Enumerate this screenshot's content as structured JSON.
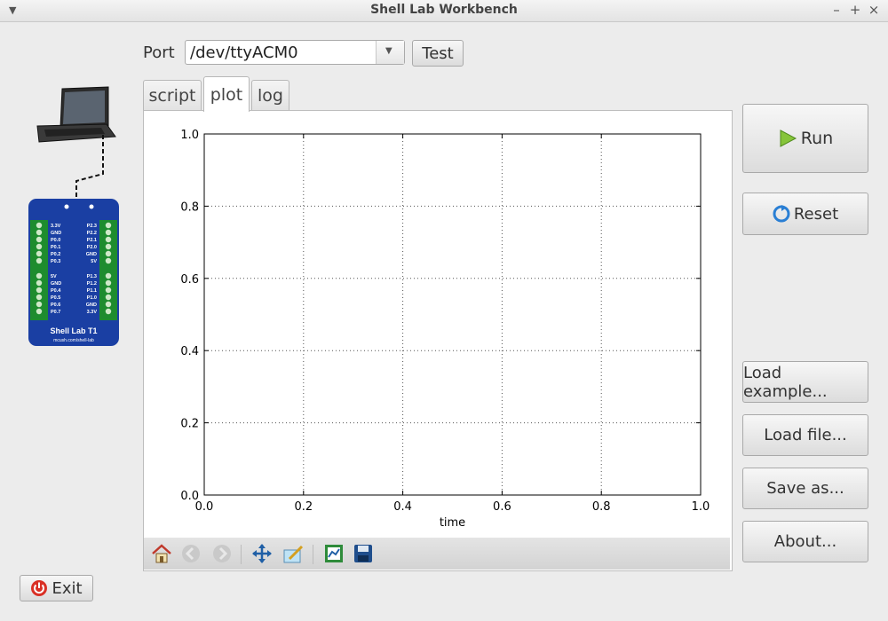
{
  "window": {
    "title": "Shell Lab Workbench",
    "controls": [
      "–",
      "+",
      "×"
    ]
  },
  "port": {
    "label": "Port",
    "value": "/dev/ttyACM0",
    "test_label": "Test"
  },
  "tabs": [
    {
      "label": "script",
      "active": false
    },
    {
      "label": "plot",
      "active": true
    },
    {
      "label": "log",
      "active": false
    }
  ],
  "board": {
    "name": "Shell Lab T1",
    "url": "mcush.com/shell-lab",
    "left_pins": [
      "3.3V",
      "GND",
      "P0.0",
      "P0.1",
      "P0.2",
      "P0.3",
      "5V",
      "GND",
      "P0.4",
      "P0.5",
      "P0.6",
      "P0.7"
    ],
    "right_pins": [
      "P2.3",
      "P2.2",
      "P2.1",
      "P2.0",
      "GND",
      "5V",
      "P1.3",
      "P1.2",
      "P1.1",
      "P1.0",
      "GND",
      "3.3V"
    ]
  },
  "buttons": {
    "run": "Run",
    "reset": "Reset",
    "load_example": "Load example...",
    "load_file": "Load file...",
    "save_as": "Save as...",
    "about": "About...",
    "exit": "Exit"
  },
  "toolbar": {
    "icons": [
      "home-icon",
      "back-icon",
      "forward-icon",
      "pan-icon",
      "zoom-icon",
      "configure-subplots-icon",
      "save-figure-icon"
    ]
  },
  "colors": {
    "run_green": "#86c43a",
    "exit_red": "#d93025",
    "board_blue": "#1a3fa3",
    "terminal_green": "#1e8c2e"
  },
  "chart_data": {
    "type": "line",
    "series": [],
    "xlabel": "time",
    "ylabel": "",
    "xlim": [
      0.0,
      1.0
    ],
    "ylim": [
      0.0,
      1.0
    ],
    "x_ticks": [
      "0.0",
      "0.2",
      "0.4",
      "0.6",
      "0.8",
      "1.0"
    ],
    "y_ticks": [
      "0.0",
      "0.2",
      "0.4",
      "0.6",
      "0.8",
      "1.0"
    ],
    "grid": true
  }
}
